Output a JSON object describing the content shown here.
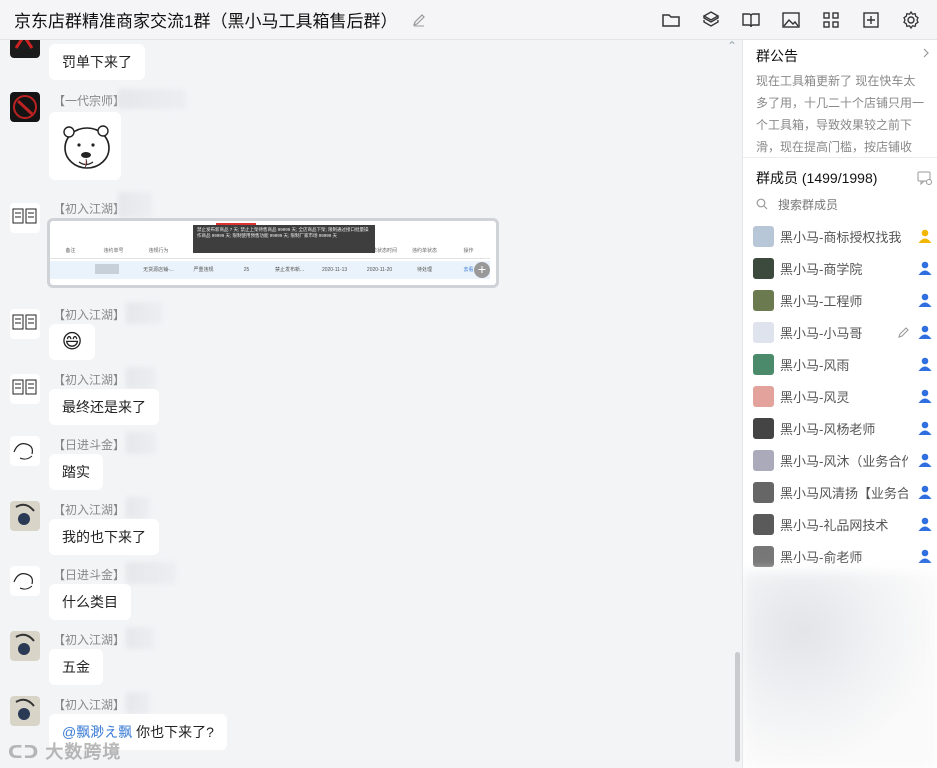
{
  "header": {
    "title": "京东店群精准商家交流1群（黑小马工具箱售后群）"
  },
  "toolbar": [
    "folder-icon",
    "cube-icon",
    "book-icon",
    "image-icon",
    "apps-icon",
    "add-icon",
    "gear-icon"
  ],
  "messages": [
    {
      "nick": "",
      "text": "罚单下来了"
    },
    {
      "nick": "【一代宗师】",
      "text": ""
    },
    {
      "nick": "【初入江湖】",
      "text": ""
    },
    {
      "nick": "【初入江湖】",
      "text": "😄"
    },
    {
      "nick": "【初入江湖】",
      "text": "最终还是来了"
    },
    {
      "nick": "【日进斗金】",
      "text": "踏实"
    },
    {
      "nick": "【初入江湖】",
      "text": "我的也下来了"
    },
    {
      "nick": "【日进斗金】",
      "text": "什么类目"
    },
    {
      "nick": "【初入江湖】",
      "text": "五金"
    },
    {
      "nick": "【初入江湖】",
      "mention": "@飘渺え飘",
      "text": " 你也下来了?"
    }
  ],
  "screenshot_table": {
    "tooltip": "禁止发布新商品 7 天; 禁止上架待售商品 99999 天; 全店商品下架; 限制通过接口批量操作商品 99999 天; 限制使用预售功能 99999 天; 限制厂家市场 99999 天",
    "headers": [
      "备注",
      "违约单号",
      "违规行为",
      "违规类型",
      "扣分",
      "违规处罚",
      "处罚开始时间",
      "违约单状态时间",
      "违约单状态",
      "操作"
    ],
    "row": [
      "",
      "",
      "无货源店铺-...",
      "严重违规",
      "25",
      "禁止发布新...",
      "2020-11-13",
      "2020-11-20",
      "待处理",
      "去看"
    ]
  },
  "notice": {
    "title": "群公告",
    "text": "现在工具箱更新了 现在快车太多了用，十几二十个店铺只用一个工具箱，导致效果较之前下滑，现在提高门槛，按店铺收费，..."
  },
  "members": {
    "title": "群成员 (1499/1998)",
    "search_placeholder": "搜索群成员",
    "list": [
      {
        "name": "黑小马-商标授权找我",
        "role": "owner"
      },
      {
        "name": "黑小马-商学院",
        "role": "admin"
      },
      {
        "name": "黑小马-工程师",
        "role": "admin"
      },
      {
        "name": "黑小马-小马哥",
        "role": "admin"
      },
      {
        "name": "黑小马-风雨",
        "role": "admin"
      },
      {
        "name": "黑小马-风灵",
        "role": "admin"
      },
      {
        "name": "黑小马-风杨老师",
        "role": "admin"
      },
      {
        "name": "黑小马-风沐（业务合作",
        "role": "admin"
      },
      {
        "name": "黑小马风清扬【业务合作",
        "role": "admin"
      },
      {
        "name": "黑小马-礼品网技术",
        "role": "admin"
      },
      {
        "name": "黑小马-俞老师",
        "role": "admin"
      }
    ]
  },
  "watermark": "大数跨境",
  "colors": {
    "accent": "#3a7bd5",
    "owner": "#f2b705",
    "admin": "#2f6fe0"
  }
}
